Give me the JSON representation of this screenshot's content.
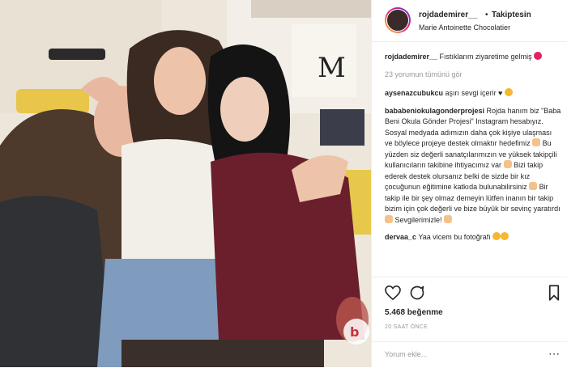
{
  "header": {
    "username": "rojdademirer__",
    "separator": "•",
    "follow_label": "Takiptesin",
    "location": "Marie Antoinette Chocolatier"
  },
  "caption": {
    "username": "rojdademirer__",
    "text": "Fıstıklarım ziyaretime gelmiş"
  },
  "view_all_comments": "23 yorumun tümünü gör",
  "comments": [
    {
      "username": "aysenazcubukcu",
      "text": "aşırı sevgi içerir ♥"
    },
    {
      "username": "bababeniokulagonderprojesi",
      "text": "Rojda hanım biz \"Baba Beni Okula Gönder Projesi\" Instagram hesabıyız. Sosyal medyada adımızın daha çok kişiye ulaşması ve böylece projeye destek olmaktır hedefimiz",
      "text2": "Bu yüzden siz değerli sanatçılarımızın ve yüksek takipçili kullanıcıların takibine ihtiyacımız var",
      "text3": "Bizi takip ederek destek olursanız belki de sizde bir kız çocuğunun eğitimine katkıda bulunabilirsiniz",
      "text4": "Bir takip ile bir şey olmaz demeyin lütfen inanın bir takip bizim için çok değerli ve bize büyük bir sevinç yaratırdı",
      "text5": "Sevgilerimizle!"
    },
    {
      "username": "dervaa_c",
      "text": "Yaa vicem bu fotoğrafı"
    }
  ],
  "actions": {
    "likes": "5.468 beğenme",
    "time": "20 SAAT ÖNCE",
    "icons": [
      "heart-icon",
      "comment-icon",
      "bookmark-icon"
    ]
  },
  "add_comment": {
    "placeholder": "Yorum ekle...",
    "more": "⋯"
  },
  "colors": {
    "text": "#262626",
    "muted": "#999999",
    "border": "#efefef"
  }
}
